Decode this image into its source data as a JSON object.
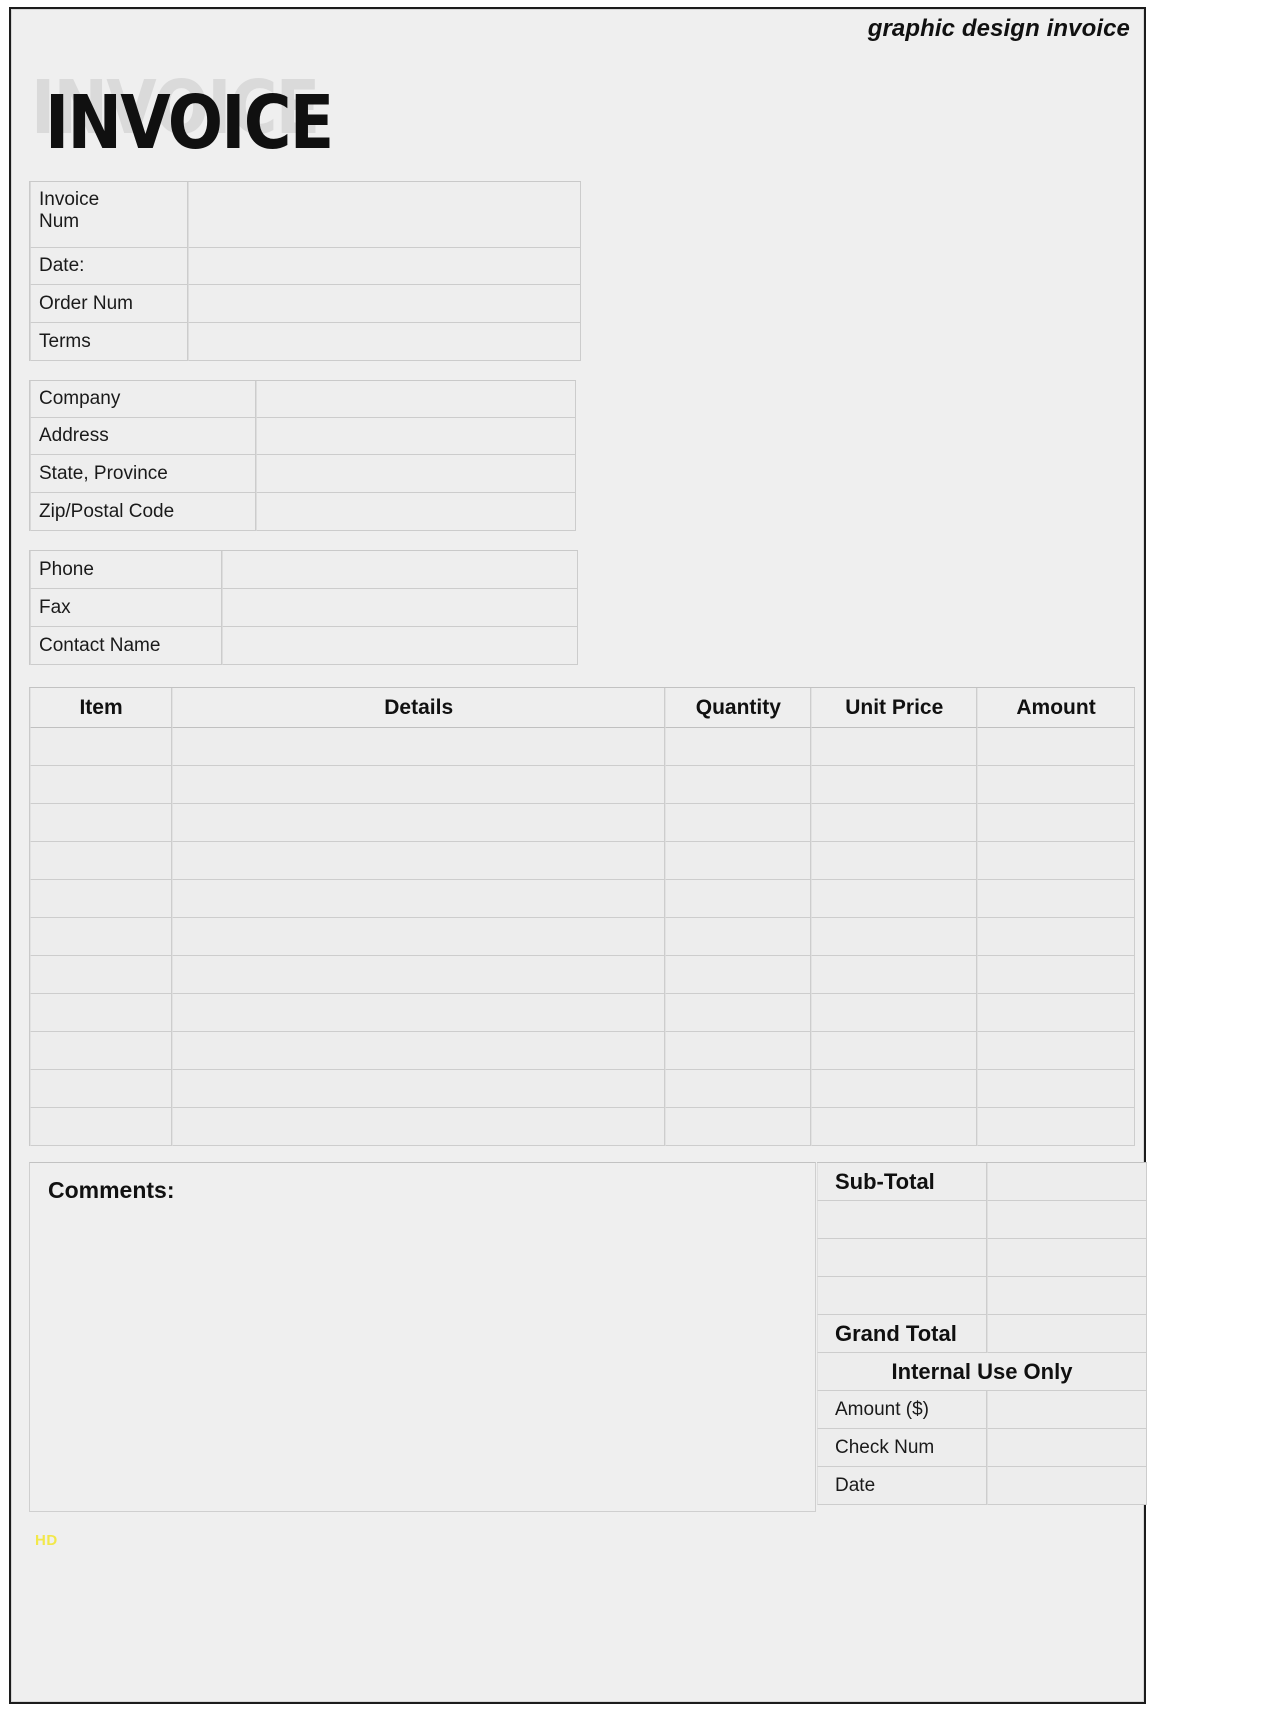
{
  "header": {
    "tagline": "graphic design invoice",
    "title": "INVOICE"
  },
  "invoice_info": {
    "rows": [
      {
        "label": "Invoice Num",
        "value": ""
      },
      {
        "label": "Date:",
        "value": ""
      },
      {
        "label": "Order Num",
        "value": ""
      },
      {
        "label": "Terms",
        "value": ""
      }
    ]
  },
  "company_info": {
    "rows": [
      {
        "label": "Company",
        "value": ""
      },
      {
        "label": "Address",
        "value": ""
      },
      {
        "label": "State, Province",
        "value": ""
      },
      {
        "label": "Zip/Postal Code",
        "value": ""
      }
    ]
  },
  "contact_info": {
    "rows": [
      {
        "label": "Phone",
        "value": ""
      },
      {
        "label": "Fax",
        "value": ""
      },
      {
        "label": "Contact Name",
        "value": ""
      }
    ]
  },
  "items_table": {
    "columns": [
      "Item",
      "Details",
      "Quantity",
      "Unit Price",
      "Amount"
    ],
    "rows": [
      [
        "",
        "",
        "",
        "",
        ""
      ],
      [
        "",
        "",
        "",
        "",
        ""
      ],
      [
        "",
        "",
        "",
        "",
        ""
      ],
      [
        "",
        "",
        "",
        "",
        ""
      ],
      [
        "",
        "",
        "",
        "",
        ""
      ],
      [
        "",
        "",
        "",
        "",
        ""
      ],
      [
        "",
        "",
        "",
        "",
        ""
      ],
      [
        "",
        "",
        "",
        "",
        ""
      ],
      [
        "",
        "",
        "",
        "",
        ""
      ],
      [
        "",
        "",
        "",
        "",
        ""
      ],
      [
        "",
        "",
        "",
        "",
        ""
      ]
    ]
  },
  "comments": {
    "label": "Comments:",
    "value": ""
  },
  "totals": {
    "rows": [
      {
        "label": "Sub-Total",
        "value": "",
        "bold": true
      },
      {
        "label": "",
        "value": "",
        "bold": false
      },
      {
        "label": "",
        "value": "",
        "bold": false
      },
      {
        "label": "",
        "value": "",
        "bold": false
      },
      {
        "label": "Grand Total",
        "value": "",
        "bold": true
      }
    ],
    "internal_banner": "Internal Use Only",
    "internal_rows": [
      {
        "label": "Amount ($)",
        "value": ""
      },
      {
        "label": "Check Num",
        "value": ""
      },
      {
        "label": "Date",
        "value": ""
      }
    ]
  },
  "watermark": "HD",
  "colors": {
    "page_background": "#efefef",
    "frame_border": "#1c1c1c",
    "cell_background": "#ededed",
    "cell_border": "#cdcdcd",
    "text": "#1a1a1a",
    "title_shadow": "#dadada",
    "watermark": "#f2e84a"
  }
}
